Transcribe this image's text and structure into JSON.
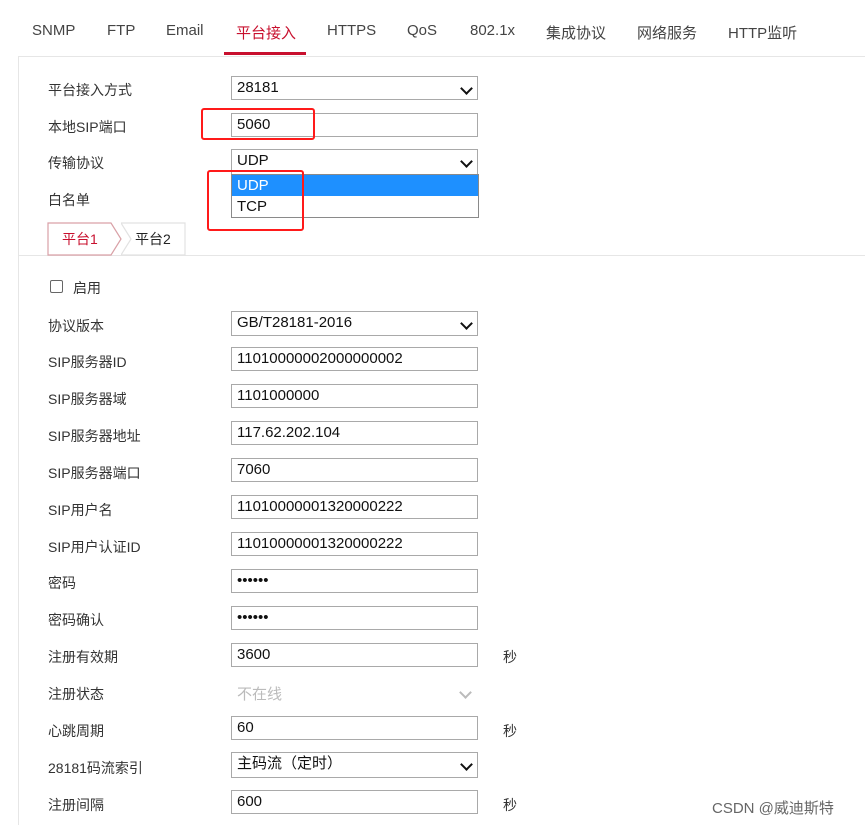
{
  "tabs": [
    {
      "label": "SNMP"
    },
    {
      "label": "FTP"
    },
    {
      "label": "Email"
    },
    {
      "label": "平台接入"
    },
    {
      "label": "HTTPS"
    },
    {
      "label": "QoS"
    },
    {
      "label": "802.1x"
    },
    {
      "label": "集成协议"
    },
    {
      "label": "网络服务"
    },
    {
      "label": "HTTP监听"
    }
  ],
  "active_tab": "平台接入",
  "accent_color": "#c8102e",
  "top_form": {
    "access_mode": {
      "label": "平台接入方式",
      "value": "28181"
    },
    "sip_port": {
      "label": "本地SIP端口",
      "value": "5060"
    },
    "transport": {
      "label": "传输协议",
      "value": "UDP",
      "options": [
        "UDP",
        "TCP"
      ],
      "highlighted": "UDP"
    },
    "whitelist": {
      "label": "白名单"
    }
  },
  "subtabs": [
    {
      "label": "平台1"
    },
    {
      "label": "平台2"
    }
  ],
  "enable": {
    "label": "启用",
    "checked": false
  },
  "fields": {
    "protocol_version": {
      "label": "协议版本",
      "value": "GB/T28181-2016"
    },
    "sip_server_id": {
      "label": "SIP服务器ID",
      "value": "11010000002000000002"
    },
    "sip_server_domain": {
      "label": "SIP服务器域",
      "value": "1101000000"
    },
    "sip_server_address": {
      "label": "SIP服务器地址",
      "value": "117.62.202.104"
    },
    "sip_server_port": {
      "label": "SIP服务器端口",
      "value": "7060"
    },
    "sip_username": {
      "label": "SIP用户名",
      "value": "11010000001320000222"
    },
    "sip_auth_id": {
      "label": "SIP用户认证ID",
      "value": "11010000001320000222"
    },
    "password": {
      "label": "密码",
      "value": "••••••"
    },
    "password_confirm": {
      "label": "密码确认",
      "value": "••••••"
    },
    "register_validity": {
      "label": "注册有效期",
      "value": "3600",
      "unit": "秒"
    },
    "register_status": {
      "label": "注册状态",
      "value": "不在线"
    },
    "heartbeat_period": {
      "label": "心跳周期",
      "value": "60",
      "unit": "秒"
    },
    "stream_index": {
      "label": "28181码流索引",
      "value": "主码流（定时）"
    },
    "register_interval": {
      "label": "注册间隔",
      "value": "600",
      "unit": "秒"
    }
  },
  "watermark": "CSDN @威迪斯特"
}
